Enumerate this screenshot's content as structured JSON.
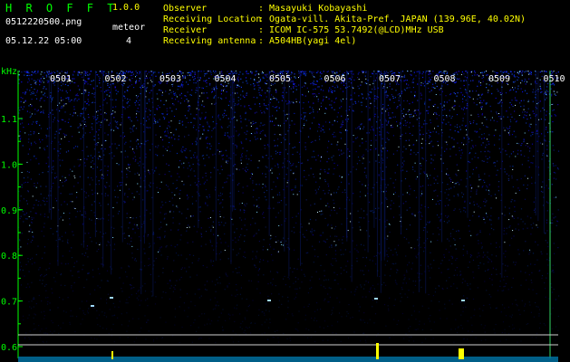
{
  "header": {
    "app_title": "H R O F F T",
    "app_version": "1.0.0",
    "file_name": "0512220500.png",
    "meteor_label": "meteor",
    "meteor_count": "4",
    "datetime": "05.12.22 05:00",
    "info": [
      {
        "key": "Observer",
        "value": ": Masayuki Kobayashi"
      },
      {
        "key": "Receiving Location",
        "value": ": Ogata-vill. Akita-Pref. JAPAN (139.96E, 40.02N)"
      },
      {
        "key": "Receiver",
        "value": ": ICOM IC-575 53.7492(@LCD)MHz USB"
      },
      {
        "key": "Receiving antenna",
        "value": ": A504HB(yagi 4el)"
      }
    ]
  },
  "chart_data": {
    "type": "heatmap",
    "title": "",
    "ylabel": "kHz",
    "ylim": [
      0.6,
      1.2
    ],
    "y_ticks": [
      "1.1",
      "1.0",
      "0.9",
      "0.8",
      "0.7",
      "0.6"
    ],
    "x_ticks": [
      "0501",
      "0502",
      "0503",
      "0504",
      "0505",
      "0506",
      "0507",
      "0508",
      "0509",
      "0510"
    ],
    "colors": {
      "background": "#000000",
      "noise": "#1a3cff",
      "text": "#00ff00",
      "marker": "#ffff00"
    }
  }
}
